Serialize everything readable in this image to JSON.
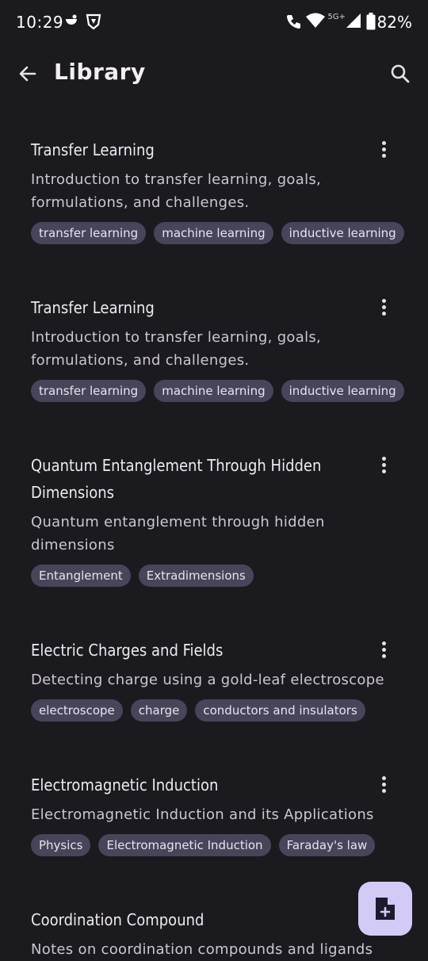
{
  "status_bar": {
    "time": "10:29",
    "network": "5G+",
    "battery": "82%"
  },
  "app_bar": {
    "title": "Library"
  },
  "notes": [
    {
      "title": "Transfer Learning",
      "description": "Introduction to transfer learning, goals, formulations, and challenges.",
      "tags": [
        "transfer learning",
        "machine learning",
        "inductive learning"
      ]
    },
    {
      "title": "Transfer Learning",
      "description": "Introduction to transfer learning, goals, formulations, and challenges.",
      "tags": [
        "transfer learning",
        "machine learning",
        "inductive learning"
      ]
    },
    {
      "title": "Quantum Entanglement Through Hidden Dimensions",
      "description": "Quantum entanglement through hidden dimensions",
      "tags": [
        "Entanglement",
        "Extradimensions"
      ]
    },
    {
      "title": "Electric Charges and Fields",
      "description": "Detecting charge using a gold-leaf electroscope",
      "tags": [
        "electroscope",
        "charge",
        "conductors and insulators"
      ]
    },
    {
      "title": "Electromagnetic Induction",
      "description": "Electromagnetic Induction and its Applications",
      "tags": [
        "Physics",
        "Electromagnetic Induction",
        "Faraday's law"
      ]
    },
    {
      "title": "Coordination Compound",
      "description": "Notes on coordination compounds and ligands",
      "tags": []
    }
  ],
  "colors": {
    "background": "#1b1a1f",
    "tag_bg": "#48455a",
    "fab_bg": "#d3cbf6"
  }
}
